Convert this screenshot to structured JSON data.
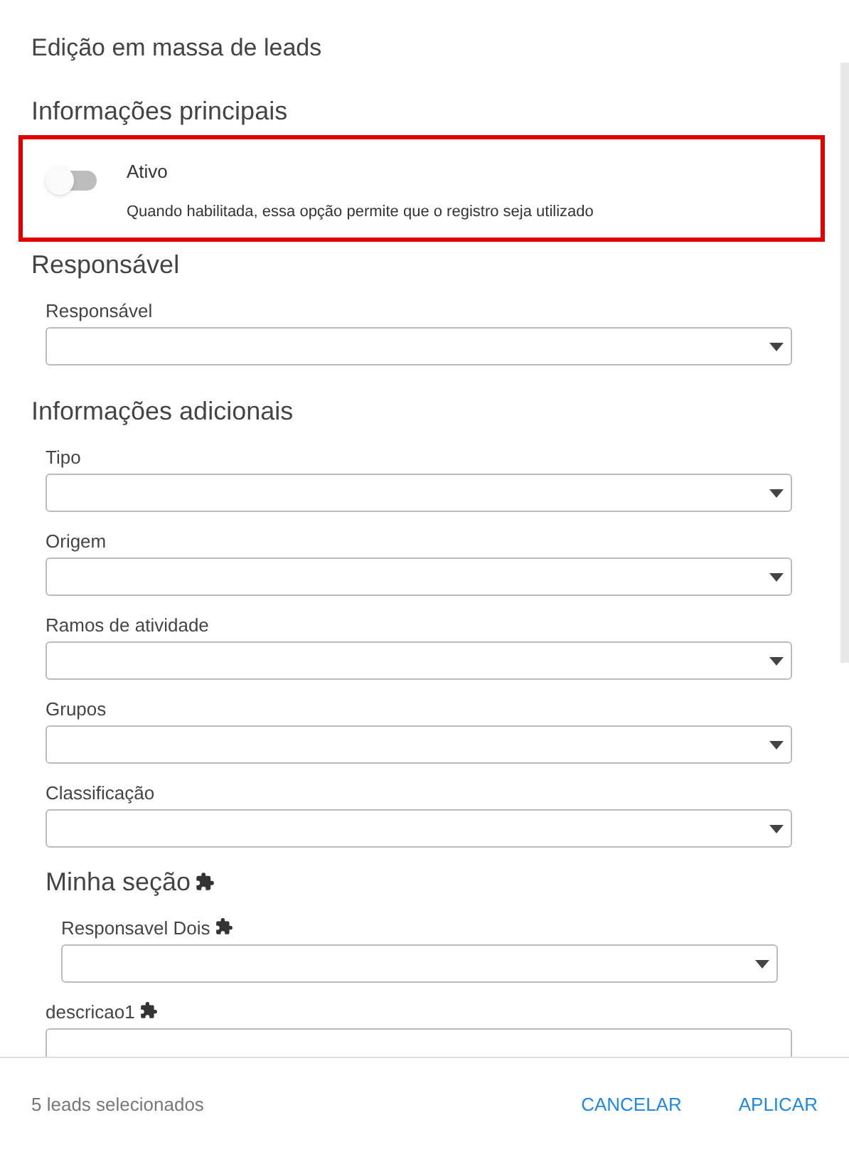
{
  "title": "Edição em massa de leads",
  "sections": [
    {
      "heading": "Informações principais",
      "highlighted": true,
      "items": [
        {
          "kind": "toggle",
          "label": "Ativo",
          "on": false,
          "help": "Quando habilitada, essa opção permite que o registro seja utilizado"
        }
      ]
    },
    {
      "heading": "Responsável",
      "highlighted": false,
      "items": [
        {
          "kind": "select",
          "label": "Responsável",
          "custom": false
        }
      ]
    },
    {
      "heading": "Informações adicionais",
      "highlighted": false,
      "items": [
        {
          "kind": "select",
          "label": "Tipo",
          "custom": false
        },
        {
          "kind": "select",
          "label": "Origem",
          "custom": false
        },
        {
          "kind": "select",
          "label": "Ramos de atividade",
          "custom": false
        },
        {
          "kind": "select",
          "label": "Grupos",
          "custom": false
        },
        {
          "kind": "select",
          "label": "Classificação",
          "custom": false
        },
        {
          "kind": "subsection",
          "heading": "Minha seção",
          "custom": true,
          "items": [
            {
              "kind": "select",
              "label": "Responsavel Dois",
              "custom": true
            }
          ]
        },
        {
          "kind": "textarea",
          "label": "descricao1",
          "custom": true
        }
      ]
    }
  ],
  "footer": {
    "count": "5 leads selecionados",
    "buttons": [
      "CANCELAR",
      "APLICAR"
    ]
  }
}
